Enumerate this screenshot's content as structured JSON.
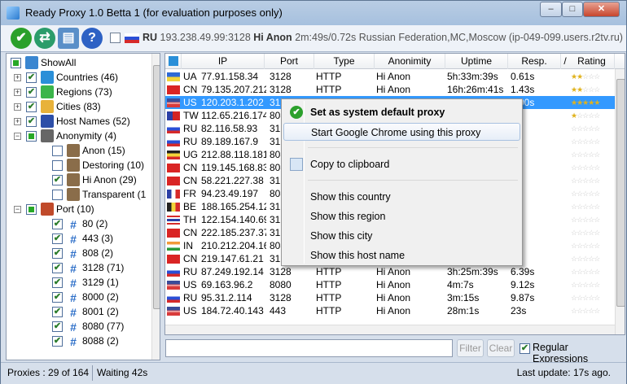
{
  "window": {
    "title": "Ready Proxy 1.0 Betta 1 (for evaluation purposes only)",
    "min": "–",
    "max": "□",
    "close": "✕"
  },
  "toolbar": {
    "country_code": "RU",
    "ip_port": "193.238.49.99:3128",
    "anonymity": "Hi Anon",
    "timing": "2m:49s/0.72s",
    "location": "Russian Federation,MC,Moscow",
    "host": "(ip-049-099.users.r2tv.ru)",
    "icons": [
      "check-icon",
      "refresh-icon",
      "export-icon",
      "help-icon"
    ]
  },
  "tree": {
    "items": [
      {
        "label": "ShowAll",
        "level": 0
      },
      {
        "label": "Countries (46)",
        "level": 1
      },
      {
        "label": "Regions (73)",
        "level": 1
      },
      {
        "label": "Cities (83)",
        "level": 1
      },
      {
        "label": "Host Names (52)",
        "level": 1
      },
      {
        "label": "Anonymity (4)",
        "level": 1
      },
      {
        "label": "Anon (15)",
        "level": 2
      },
      {
        "label": "Destoring (10)",
        "level": 2
      },
      {
        "label": "Hi Anon (29)",
        "level": 2
      },
      {
        "label": "Transparent (1",
        "level": 2
      },
      {
        "label": "Port (10)",
        "level": 1
      },
      {
        "label": "80 (2)",
        "level": 2
      },
      {
        "label": "443 (3)",
        "level": 2
      },
      {
        "label": "808 (2)",
        "level": 2
      },
      {
        "label": "3128 (71)",
        "level": 2
      },
      {
        "label": "3129 (1)",
        "level": 2
      },
      {
        "label": "8000 (2)",
        "level": 2
      },
      {
        "label": "8001 (2)",
        "level": 2
      },
      {
        "label": "8080 (77)",
        "level": 2
      },
      {
        "label": "8088 (2)",
        "level": 2
      }
    ]
  },
  "grid": {
    "headers": [
      "IP",
      "Port",
      "Type",
      "Anonimity",
      "Uptime",
      "Resp.",
      "/",
      "Rating"
    ],
    "rows": [
      {
        "cc": "UA",
        "ip": "77.91.158.34",
        "port": "3128",
        "type": "HTTP",
        "anon": "Hi Anon",
        "uptime": "5h:33m:39s",
        "resp": "0.61s",
        "stars": 2
      },
      {
        "cc": "CN",
        "ip": "79.135.207.212",
        "port": "3128",
        "type": "HTTP",
        "anon": "Hi Anon",
        "uptime": "16h:26m:41s",
        "resp": "1.43s",
        "stars": 2
      },
      {
        "cc": "US",
        "ip": "120.203.1.202",
        "port": "3128",
        "type": "HTTP",
        "anon": "Hi Anon",
        "uptime": "2d:11h:56m:55s",
        "resp": "2.00s",
        "stars": 5
      },
      {
        "cc": "TW",
        "ip": "112.65.216.174",
        "port": "8080",
        "type": "",
        "anon": "",
        "uptime": "",
        "resp": "s",
        "stars": 1
      },
      {
        "cc": "RU",
        "ip": "82.116.58.93",
        "port": "3128",
        "type": "",
        "anon": "",
        "uptime": "",
        "resp": "s",
        "stars": 0
      },
      {
        "cc": "RU",
        "ip": "89.189.167.9",
        "port": "3128",
        "type": "",
        "anon": "",
        "uptime": "",
        "resp": "s",
        "stars": 0
      },
      {
        "cc": "UG",
        "ip": "212.88.118.181",
        "port": "8080",
        "type": "",
        "anon": "",
        "uptime": "",
        "resp": "s",
        "stars": 0
      },
      {
        "cc": "CN",
        "ip": "119.145.168.83",
        "port": "8080",
        "type": "",
        "anon": "",
        "uptime": "",
        "resp": "s",
        "stars": 0
      },
      {
        "cc": "CN",
        "ip": "58.221.227.38",
        "port": "3128",
        "type": "",
        "anon": "",
        "uptime": "",
        "resp": "s",
        "stars": 0
      },
      {
        "cc": "FR",
        "ip": "94.23.49.197",
        "port": "8080",
        "type": "",
        "anon": "",
        "uptime": "",
        "resp": "s",
        "stars": 0
      },
      {
        "cc": "BE",
        "ip": "188.165.254.123",
        "port": "312",
        "type": "",
        "anon": "",
        "uptime": "",
        "resp": "s",
        "stars": 0
      },
      {
        "cc": "TH",
        "ip": "122.154.140.69",
        "port": "312",
        "type": "",
        "anon": "",
        "uptime": "",
        "resp": "s",
        "stars": 0
      },
      {
        "cc": "CN",
        "ip": "222.185.237.37",
        "port": "312",
        "type": "",
        "anon": "",
        "uptime": "",
        "resp": "s",
        "stars": 0
      },
      {
        "cc": "IN",
        "ip": "210.212.204.163",
        "port": "808",
        "type": "",
        "anon": "",
        "uptime": "",
        "resp": "s",
        "stars": 0
      },
      {
        "cc": "CN",
        "ip": "219.147.61.21",
        "port": "312",
        "type": "",
        "anon": "",
        "uptime": "",
        "resp": "s",
        "stars": 0
      },
      {
        "cc": "RU",
        "ip": "87.249.192.14",
        "port": "3128",
        "type": "HTTP",
        "anon": "Hi Anon",
        "uptime": "3h:25m:39s",
        "resp": "6.39s",
        "stars": 0
      },
      {
        "cc": "US",
        "ip": "69.163.96.2",
        "port": "8080",
        "type": "HTTP",
        "anon": "Hi Anon",
        "uptime": "4m:7s",
        "resp": "9.12s",
        "stars": 0
      },
      {
        "cc": "RU",
        "ip": "95.31.2.114",
        "port": "3128",
        "type": "HTTP",
        "anon": "Hi Anon",
        "uptime": "3m:15s",
        "resp": "9.87s",
        "stars": 0
      },
      {
        "cc": "US",
        "ip": "184.72.40.143",
        "port": "443",
        "type": "HTTP",
        "anon": "Hi Anon",
        "uptime": "28m:1s",
        "resp": "23s",
        "stars": 0
      }
    ]
  },
  "context_menu": {
    "items": [
      "Set as system default proxy",
      "Start Google Chrome using this proxy",
      "Copy to clipboard",
      "Show this country",
      "Show this region",
      "Show this city",
      "Show this host name"
    ]
  },
  "filter": {
    "placeholder": "",
    "value": "",
    "filter_button": "Filter",
    "clear_button": "Clear",
    "regex_label": "Regular Expressions"
  },
  "status": {
    "proxies": "Proxies : 29 of 164",
    "waiting": "Waiting 42s",
    "last_update": "Last update: 17s ago."
  }
}
